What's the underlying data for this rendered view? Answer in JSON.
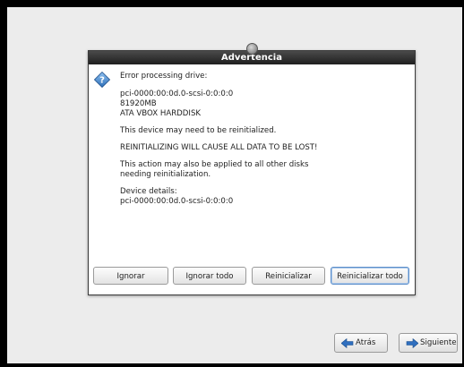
{
  "dialog": {
    "title": "Advertencia",
    "icon": "warning-diamond-icon",
    "message": {
      "line1": "Error processing drive:",
      "device_path": "pci-0000:00:0d.0-scsi-0:0:0:0",
      "size": "81920MB",
      "model": "ATA VBOX HARDDISK",
      "notice": "This device may need to be reinitialized.",
      "warning": "REINITIALIZING WILL CAUSE ALL DATA TO BE LOST!",
      "apply_line1": "This action may also be applied to all other disks",
      "apply_line2": "needing reinitialization.",
      "details_label": "Device details:",
      "details_value": "pci-0000:00:0d.0-scsi-0:0:0:0"
    },
    "buttons": {
      "ignore": "Ignorar",
      "ignore_all": "Ignorar todo",
      "reinitialize": "Reinicializar",
      "reinitialize_all": "Reinicializar todo"
    }
  },
  "navigation": {
    "back_label": "Atrás",
    "next_label": "Siguiente"
  },
  "colors": {
    "titlebar": "#2b2b2b",
    "accent": "#3a78c2",
    "background": "#ececec"
  }
}
